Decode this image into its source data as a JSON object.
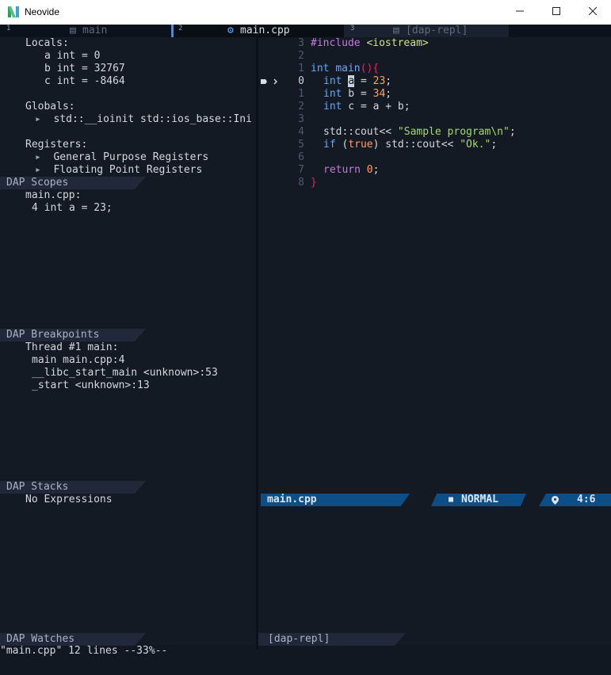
{
  "window": {
    "title": "Neovide"
  },
  "tabs": [
    {
      "num": "1",
      "label": "main"
    },
    {
      "num": "2",
      "label": "main.cpp"
    },
    {
      "num": "3",
      "label": "[dap-repl]"
    }
  ],
  "icons": {
    "tab_file_1": "file-icon",
    "tab_file_2": "cpp-icon",
    "tab_file_3": "file-icon",
    "breakpoint": "breakpoint-icon",
    "location": "location-pin-icon",
    "mode": "mode-icon"
  },
  "scopes": {
    "locals_label": "Locals:",
    "locals": [
      {
        "name": "a",
        "type": "int",
        "value": "0"
      },
      {
        "name": "b",
        "type": "int",
        "value": "32767"
      },
      {
        "name": "c",
        "type": "int",
        "value": "-8464"
      }
    ],
    "globals_label": "Globals:",
    "globals_item": "std::__ioinit std::ios_base::Ini",
    "registers_label": "Registers:",
    "registers": [
      "General Purpose Registers",
      "Floating Point Registers"
    ],
    "header": "DAP Scopes"
  },
  "breakpoints": {
    "file": "main.cpp:",
    "entry": "4 int a = 23;",
    "header": "DAP Breakpoints"
  },
  "stacks": {
    "thread": "Thread #1 main:",
    "frames": [
      "main main.cpp:4",
      "__libc_start_main <unknown>:53",
      "_start <unknown>:13"
    ],
    "header": "DAP Stacks"
  },
  "watches": {
    "empty": "No Expressions",
    "header": "DAP Watches"
  },
  "repl": {
    "header": "[dap-repl]"
  },
  "code": {
    "line_numbers": [
      "3",
      "2",
      "1",
      "0",
      "1",
      "2",
      "3",
      "4",
      "5",
      "6",
      "7",
      "8"
    ],
    "include_kw": "#include",
    "include_lib": "<iostream>",
    "main_sig_kw": "int",
    "main_sig_fn": "main",
    "main_paren": "(){",
    "int_kw": "int",
    "a_name": "a",
    "a_rest": " = ",
    "a_val": "23",
    "a_semi": ";",
    "b_text": " b = ",
    "b_val": "34",
    "b_semi": ";",
    "c_text": " c = a + b;",
    "cout1": "std::cout<< ",
    "cout1_str": "\"Sample program\\n\"",
    "cout1_end": ";",
    "if_kw": "if",
    "if_open": " (",
    "if_bool": "true",
    "if_close": ") std::cout<< ",
    "cout2_str": "\"Ok.\"",
    "cout2_end": ";",
    "return_kw": "return",
    "return_val": "0",
    "return_end": ";",
    "close_brace": "}"
  },
  "statusline": {
    "file": "main.cpp",
    "mode": "NORMAL",
    "position": "4:6"
  },
  "message": "\"main.cpp\" 12 lines --33%--",
  "colors": {
    "accent": "#0e4e86",
    "background": "#131a24"
  }
}
